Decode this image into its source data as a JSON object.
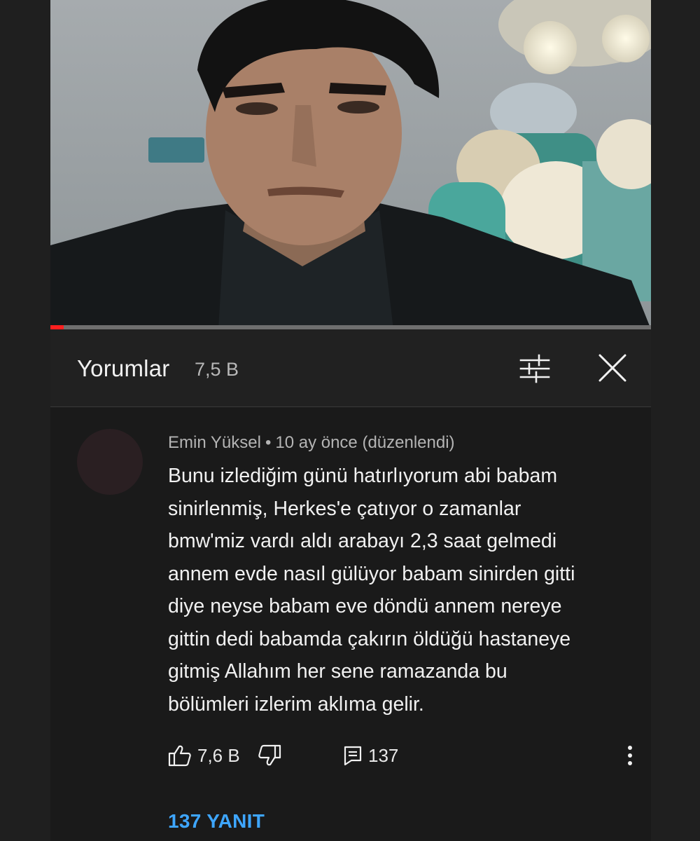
{
  "video": {
    "progress_fraction": 0.022
  },
  "comments_panel": {
    "title": "Yorumlar",
    "count": "7,5 B"
  },
  "comment": {
    "author": "Emin Yüksel",
    "separator": "•",
    "time": "10 ay önce (düzenlendi)",
    "text_lines": [
      "Bunu izlediğim günü hatırlıyorum abi babam",
      "sinirlenmiş, Herkes'e çatıyor o zamanlar",
      "bmw'miz vardı aldı arabayı 2,3 saat gelmedi",
      "annem evde nasıl gülüyor babam sinirden gitti",
      "diye neyse babam eve döndü annem  nereye",
      "gittin dedi babamda çakırın öldüğü hastaneye",
      "gitmiş Allahım her sene ramazanda bu",
      "bölümleri izlerim aklıma gelir."
    ],
    "likes": "7,6 B",
    "replies_count": "137",
    "replies_link": "137 YANIT"
  },
  "icons": {
    "sort": "sort-filter-icon",
    "close": "close-icon",
    "like": "thumbs-up-icon",
    "dislike": "thumbs-down-icon",
    "reply": "reply-comment-icon",
    "more": "more-vertical-icon"
  },
  "colors": {
    "background": "#1f1f1f",
    "header": "#212121",
    "link": "#3ea6ff",
    "progress": "#ff1f1f"
  }
}
